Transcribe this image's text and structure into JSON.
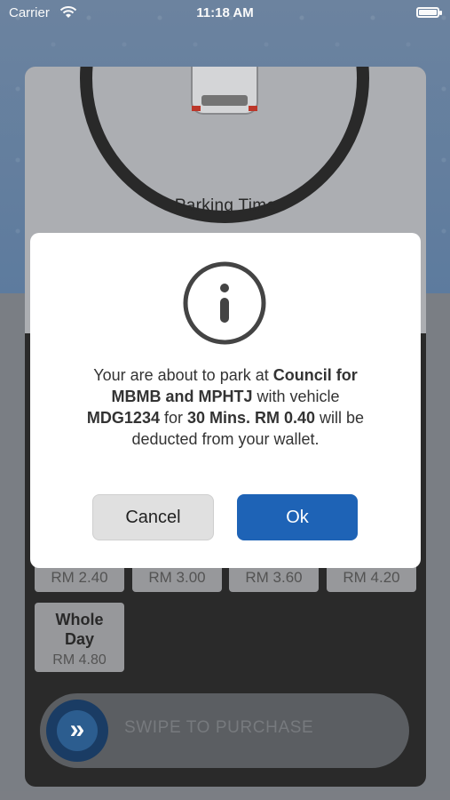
{
  "status_bar": {
    "carrier": "Carrier",
    "time": "11:18 AM",
    "wifi_icon": "wifi-icon",
    "battery_icon": "battery-icon"
  },
  "card": {
    "car_icon": "car-icon",
    "parking_time_label": "Parking Time",
    "price_options": [
      {
        "price": "RM 2.40"
      },
      {
        "price": "RM 3.00"
      },
      {
        "price": "RM 3.60"
      },
      {
        "price": "RM 4.20"
      }
    ],
    "whole_day": {
      "title_line1": "Whole",
      "title_line2": "Day",
      "price": "RM 4.80"
    },
    "swipe": {
      "label": "SWIPE TO PURCHASE",
      "icon": "double-chevron-right-icon"
    }
  },
  "dialog": {
    "icon": "info-icon",
    "message_parts": {
      "p1": "Your are about to park at ",
      "location": "Council for MBMB and MPHTJ",
      "p2": " with vehicle ",
      "vehicle": "MDG1234",
      "p3": " for ",
      "duration_price": "30 Mins. RM 0.40",
      "p4": " will be deducted from your wallet."
    },
    "cancel_label": "Cancel",
    "ok_label": "Ok"
  },
  "colors": {
    "primary": "#1e63b6",
    "cancel_bg": "#e0e0e0",
    "dark_panel": "#2b2b2b"
  }
}
